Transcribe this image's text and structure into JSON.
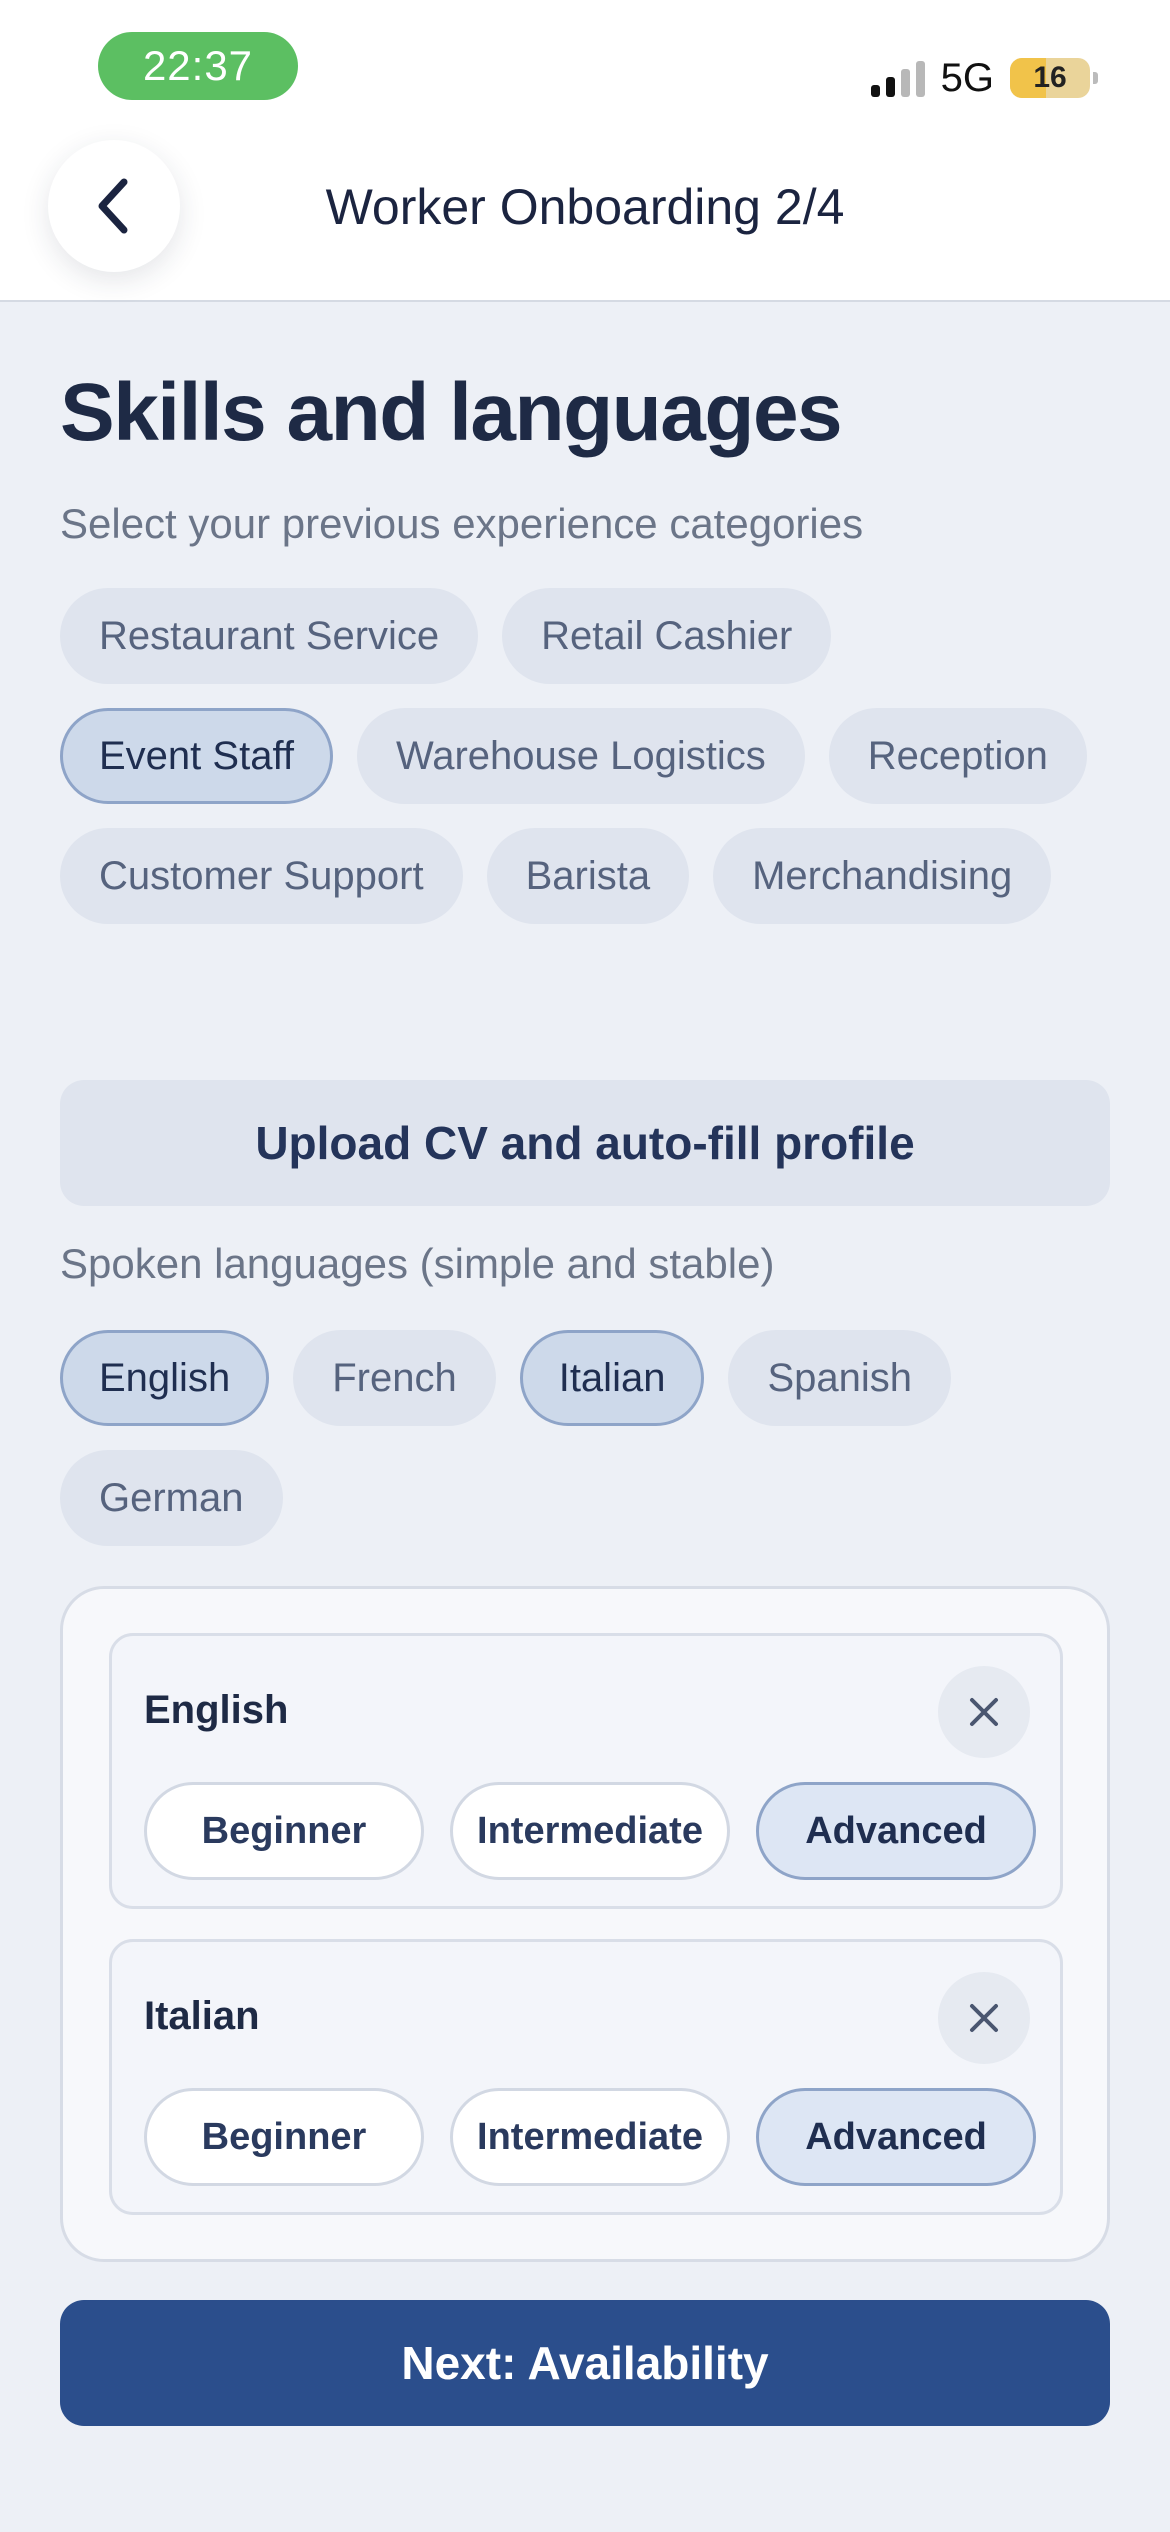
{
  "status_bar": {
    "time": "22:37",
    "network": "5G",
    "battery": "16"
  },
  "header": {
    "back_icon": "chevron-left-icon",
    "title": "Worker Onboarding 2/4"
  },
  "page": {
    "title": "Skills and languages",
    "subtitle": "Select your previous experience categories"
  },
  "categories": [
    {
      "label": "Restaurant Service",
      "selected": false
    },
    {
      "label": "Retail Cashier",
      "selected": false
    },
    {
      "label": "Event Staff",
      "selected": true
    },
    {
      "label": "Warehouse Logistics",
      "selected": false
    },
    {
      "label": "Reception",
      "selected": false
    },
    {
      "label": "Customer Support",
      "selected": false
    },
    {
      "label": "Barista",
      "selected": false
    },
    {
      "label": "Merchandising",
      "selected": false
    }
  ],
  "upload_button": "Upload CV and auto-fill profile",
  "languages_label": "Spoken languages (simple and stable)",
  "languages": [
    {
      "label": "English",
      "selected": true
    },
    {
      "label": "French",
      "selected": false
    },
    {
      "label": "Italian",
      "selected": true
    },
    {
      "label": "Spanish",
      "selected": false
    },
    {
      "label": "German",
      "selected": false
    }
  ],
  "language_levels": [
    {
      "name": "English",
      "remove_icon": "close-icon",
      "levels": [
        "Beginner",
        "Intermediate",
        "Advanced"
      ],
      "selected_level": "Advanced"
    },
    {
      "name": "Italian",
      "remove_icon": "close-icon",
      "levels": [
        "Beginner",
        "Intermediate",
        "Advanced"
      ],
      "selected_level": "Advanced"
    }
  ],
  "next_button": "Next: Availability",
  "colors": {
    "primary": "#2b4e8c",
    "status_green": "#5cbf62",
    "background": "#edf0f6",
    "chip": "#dfe4ee",
    "chip_selected": "#cdd9ea"
  }
}
